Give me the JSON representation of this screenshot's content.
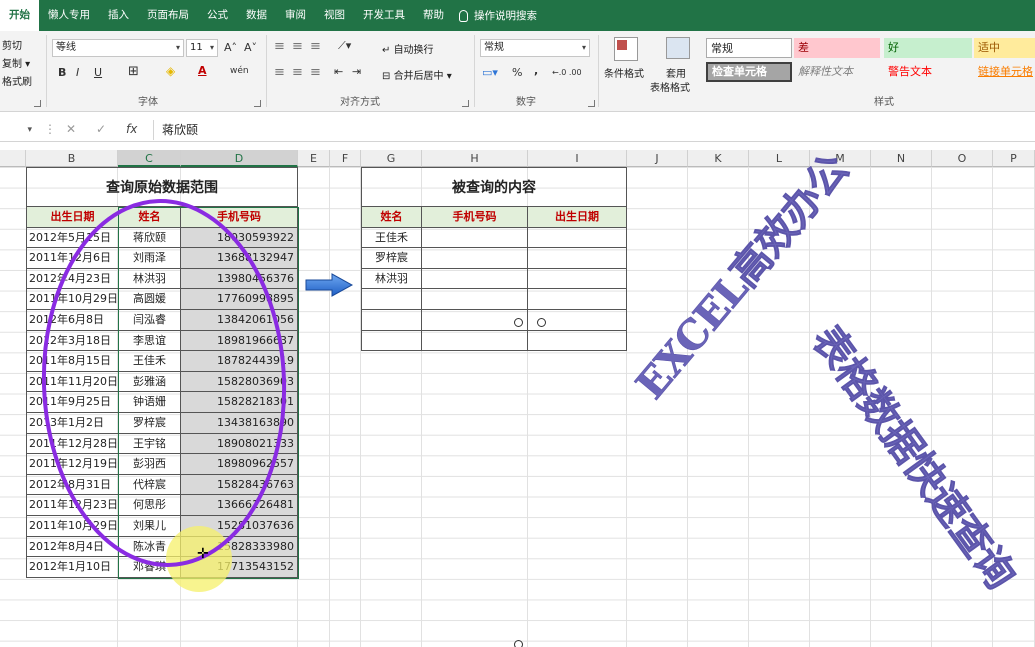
{
  "tabs": [
    {
      "label": "开始",
      "active": true
    },
    {
      "label": "懒人专用"
    },
    {
      "label": "插入"
    },
    {
      "label": "页面布局"
    },
    {
      "label": "公式"
    },
    {
      "label": "数据"
    },
    {
      "label": "审阅"
    },
    {
      "label": "视图"
    },
    {
      "label": "开发工具"
    },
    {
      "label": "帮助"
    }
  ],
  "tell_me": "操作说明搜索",
  "ribbon": {
    "clipboard": {
      "cut": "剪切",
      "copy": "复制 ▾",
      "painter": "格式刷"
    },
    "font": {
      "name": "等线",
      "size": "11",
      "group_label": "字体",
      "grow": "A˄",
      "shrink": "A˅",
      "bold": "B",
      "italic": "I",
      "underline": "U",
      "wen": "wén"
    },
    "alignment": {
      "wrap": "自动换行",
      "merge": "合并后居中",
      "group_label": "对齐方式"
    },
    "number": {
      "format": "常规",
      "percent": "%",
      "comma": ",",
      "inc": "←.0 .00",
      "dec": ".00 →.0",
      "group_label": "数字"
    },
    "buttons": {
      "cond_format": "条件格式",
      "table_format_1": "套用",
      "table_format_2": "表格格式"
    },
    "styles": {
      "group_label": "样式",
      "items": [
        "常规",
        "差",
        "好",
        "适中",
        "检查单元格",
        "解释性文本",
        "警告文本",
        "链接单元格"
      ]
    }
  },
  "formula_bar": {
    "name_box": "▾",
    "fx": "fx",
    "content": "蒋欣颐"
  },
  "columns": [
    "B",
    "C",
    "D",
    "E",
    "F",
    "G",
    "H",
    "I",
    "J",
    "K",
    "L",
    "M",
    "N",
    "O",
    "P"
  ],
  "source_table": {
    "title": "查询原始数据范围",
    "headers": [
      "出生日期",
      "姓名",
      "手机号码"
    ],
    "rows": [
      [
        "2012年5月15日",
        "蒋欣颐",
        "18030593922"
      ],
      [
        "2011年12月6日",
        "刘雨泽",
        "13688132947"
      ],
      [
        "2012年4月23日",
        "林洪羽",
        "13980456376"
      ],
      [
        "2011年10月29日",
        "高圆媛",
        "17760998895"
      ],
      [
        "2012年6月8日",
        "闫泓睿",
        "13842061056"
      ],
      [
        "2012年3月18日",
        "李思谊",
        "18981966637"
      ],
      [
        "2011年8月15日",
        "王佳禾",
        "18782443919"
      ],
      [
        "2011年11月20日",
        "彭雅涵",
        "15828036903"
      ],
      [
        "2011年9月25日",
        "钟语姗",
        "15828218301"
      ],
      [
        "2013年1月2日",
        "罗梓宸",
        "13438163890"
      ],
      [
        "2011年12月28日",
        "王宇铭",
        "18908021333"
      ],
      [
        "2011年12月19日",
        "彭羽西",
        "18980962557"
      ],
      [
        "2012年8月31日",
        "代梓宸",
        "15828436763"
      ],
      [
        "2011年12月23日",
        "何思彤",
        "13666126481"
      ],
      [
        "2011年10月29日",
        "刘果儿",
        "15281037636"
      ],
      [
        "2012年8月4日",
        "陈冰青",
        "15828333980"
      ],
      [
        "2012年1月10日",
        "邓睿琪",
        "17713543152"
      ]
    ]
  },
  "query_table": {
    "title": "被查询的内容",
    "headers": [
      "姓名",
      "手机号码",
      "出生日期"
    ],
    "names": [
      "王佳禾",
      "罗梓宸",
      "林洪羽",
      "",
      "",
      ""
    ]
  },
  "watermarks": [
    "EXCEL高效办公",
    "表格数据快速查询"
  ],
  "colors": {
    "excel_green": "#217346",
    "header_fill": "#e2efda",
    "header_text": "#c00000",
    "phone_fill": "#d9d9d9",
    "annotation_purple": "#8a2be2",
    "highlight_yellow": "#f6f06a",
    "arrow_blue": "#2e75d6"
  }
}
